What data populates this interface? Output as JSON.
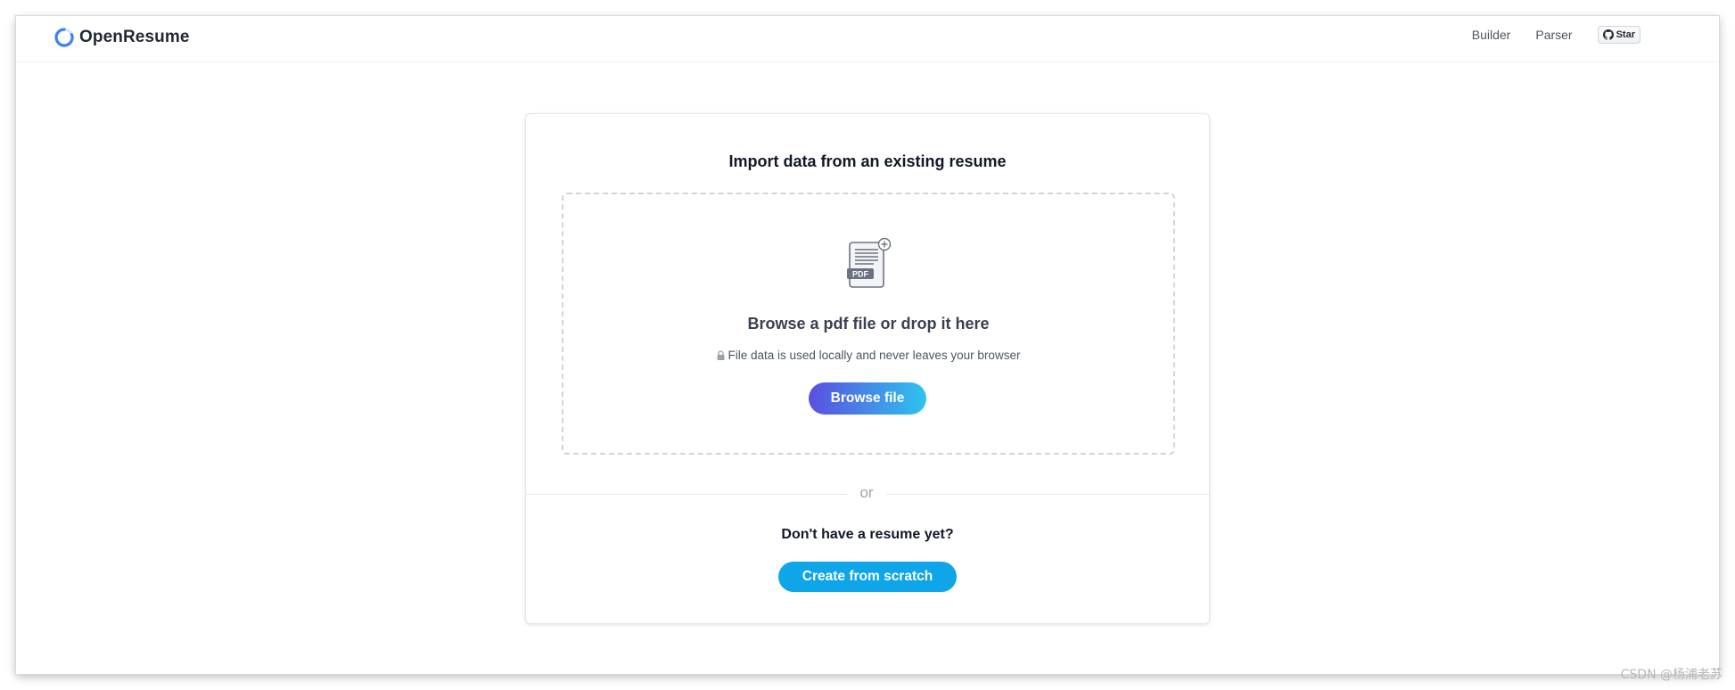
{
  "brand": {
    "name": "OpenResume",
    "accent": "#4f82e0"
  },
  "nav": {
    "items": [
      "Builder",
      "Parser"
    ],
    "star_label": "Star"
  },
  "import": {
    "title": "Import data from an existing resume",
    "drop_title": "Browse a pdf file or drop it here",
    "privacy_note": "File data is used locally and never leaves your browser",
    "browse_label": "Browse file",
    "pdf_badge": "PDF"
  },
  "divider_text": "or",
  "scratch": {
    "question": "Don't have a resume yet?",
    "button_label": "Create from scratch",
    "button_color": "#0ea5e9"
  },
  "watermark": "CSDN @杨浦老苏"
}
